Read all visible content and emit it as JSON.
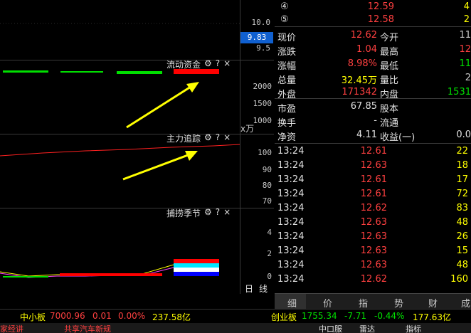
{
  "price_axis": {
    "upper": "10.0",
    "lower": "9.5",
    "current": "9.83"
  },
  "panels": {
    "fund_flow": {
      "title": "流动资金",
      "axis": [
        "2000",
        "1500",
        "1000"
      ],
      "unit": "万"
    },
    "main_tracking": {
      "title": "主力追踪",
      "axis": [
        "100",
        "90",
        "80",
        "70"
      ]
    },
    "seasons": {
      "title": "捕捞季节",
      "axis": [
        "4",
        "2",
        "0"
      ]
    }
  },
  "tool_icons": {
    "gear": "⚙",
    "help": "?",
    "close": "×"
  },
  "period_buttons": {
    "day": "日",
    "line": "线"
  },
  "order_book": [
    {
      "level": "④",
      "price": "12.59",
      "vol": "4"
    },
    {
      "level": "⑤",
      "price": "12.58",
      "vol": "2"
    }
  ],
  "quote": {
    "rows": [
      {
        "l1": "现价",
        "v1": "12.62",
        "c1": "red",
        "l2": "今开",
        "v2": "11",
        "c2": "gray"
      },
      {
        "l1": "涨跌",
        "v1": "1.04",
        "c1": "red",
        "l2": "最高",
        "v2": "12",
        "c2": "red"
      },
      {
        "l1": "涨幅",
        "v1": "8.98%",
        "c1": "red",
        "l2": "最低",
        "v2": "11",
        "c2": "green"
      },
      {
        "l1": "总量",
        "v1": "32.45万",
        "c1": "yellow",
        "l2": "量比",
        "v2": "2",
        "c2": "gray"
      },
      {
        "l1": "外盘",
        "v1": "171342",
        "c1": "red",
        "l2": "内盘",
        "v2": "1531",
        "c2": "green"
      }
    ],
    "rows2": [
      {
        "l1": "市盈",
        "v1": "67.85",
        "l2": "股本",
        "v2": ""
      },
      {
        "l1": "换手",
        "v1": "-",
        "l2": "流通",
        "v2": ""
      },
      {
        "l1": "净资",
        "v1": "4.11",
        "l2": "收益(一)",
        "v2": "0.0"
      }
    ]
  },
  "ticks": [
    {
      "time": "13:24",
      "price": "12.61",
      "vol": "22"
    },
    {
      "time": "13:24",
      "price": "12.63",
      "vol": "18"
    },
    {
      "time": "13:24",
      "price": "12.61",
      "vol": "17"
    },
    {
      "time": "13:24",
      "price": "12.61",
      "vol": "72"
    },
    {
      "time": "13:24",
      "price": "12.62",
      "vol": "83"
    },
    {
      "time": "13:24",
      "price": "12.63",
      "vol": "48"
    },
    {
      "time": "13:24",
      "price": "12.63",
      "vol": "26"
    },
    {
      "time": "13:24",
      "price": "12.63",
      "vol": "15"
    },
    {
      "time": "13:24",
      "price": "12.63",
      "vol": "48"
    },
    {
      "time": "13:24",
      "price": "12.62",
      "vol": "160"
    }
  ],
  "tabs": [
    "细",
    "价",
    "指",
    "势",
    "财",
    "成"
  ],
  "index_bar": {
    "sme": {
      "name": "中小板",
      "value": "7000.96",
      "change": "0.01",
      "pct": "0.00%",
      "amount": "237.58亿"
    },
    "gem": {
      "name": "创业板",
      "value": "1755.34",
      "change": "-7.71",
      "pct": "-0.44%",
      "amount": "177.63亿"
    }
  },
  "status": {
    "left1": "家经讲",
    "left2": "共享汽车新规",
    "right1": "中口服",
    "right2": "雷达",
    "right3": "指标"
  },
  "colors": {
    "up": "#ff4040",
    "down": "#00e000",
    "volume": "#ffff00"
  }
}
